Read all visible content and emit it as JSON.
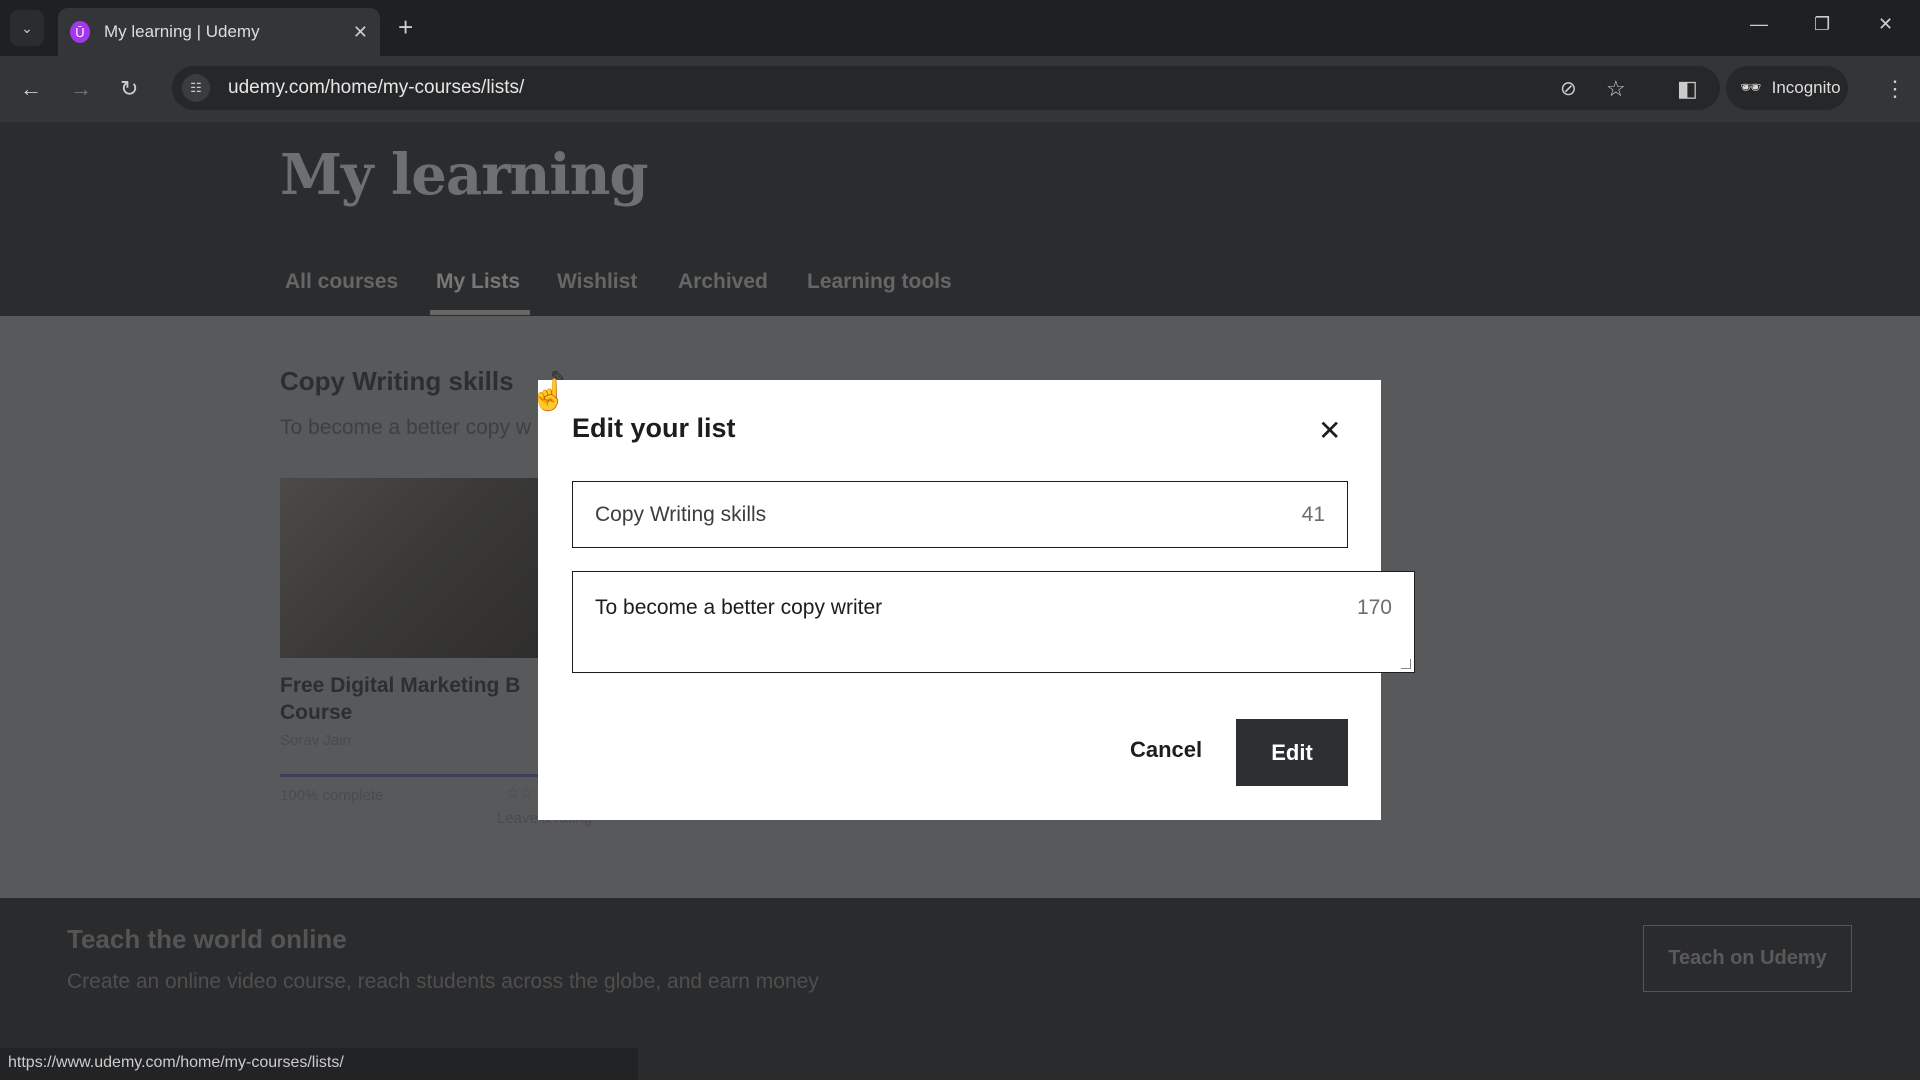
{
  "browser": {
    "tab_title": "My learning | Udemy",
    "favicon_letter": "Ū",
    "url": "udemy.com/home/my-courses/lists/",
    "profile_label": "Incognito",
    "status_url": "https://www.udemy.com/home/my-courses/lists/"
  },
  "page": {
    "title": "My learning",
    "tabs": [
      {
        "label": "All courses"
      },
      {
        "label": "My Lists",
        "active": true
      },
      {
        "label": "Wishlist"
      },
      {
        "label": "Archived"
      },
      {
        "label": "Learning tools"
      }
    ],
    "list": {
      "name": "Copy Writing skills",
      "description": "To become a better copy w",
      "course": {
        "title_line1": "Free Digital Marketing B",
        "title_line2": "Course",
        "author": "Sorav Jain",
        "progress_label": "100% complete",
        "progress": 100,
        "rating_label": "Leave a rating"
      }
    },
    "footer": {
      "heading": "Teach the world online",
      "text": "Create an online video course, reach students across the globe, and earn money",
      "button": "Teach on Udemy"
    }
  },
  "modal": {
    "title": "Edit your list",
    "name_value": "Copy Writing skills",
    "name_remaining": "41",
    "description_value": "To become a better copy writer",
    "description_remaining": "170",
    "cancel_label": "Cancel",
    "edit_label": "Edit"
  },
  "colors": {
    "brand": "#a435f0",
    "primary_button": "#2d2f31"
  }
}
